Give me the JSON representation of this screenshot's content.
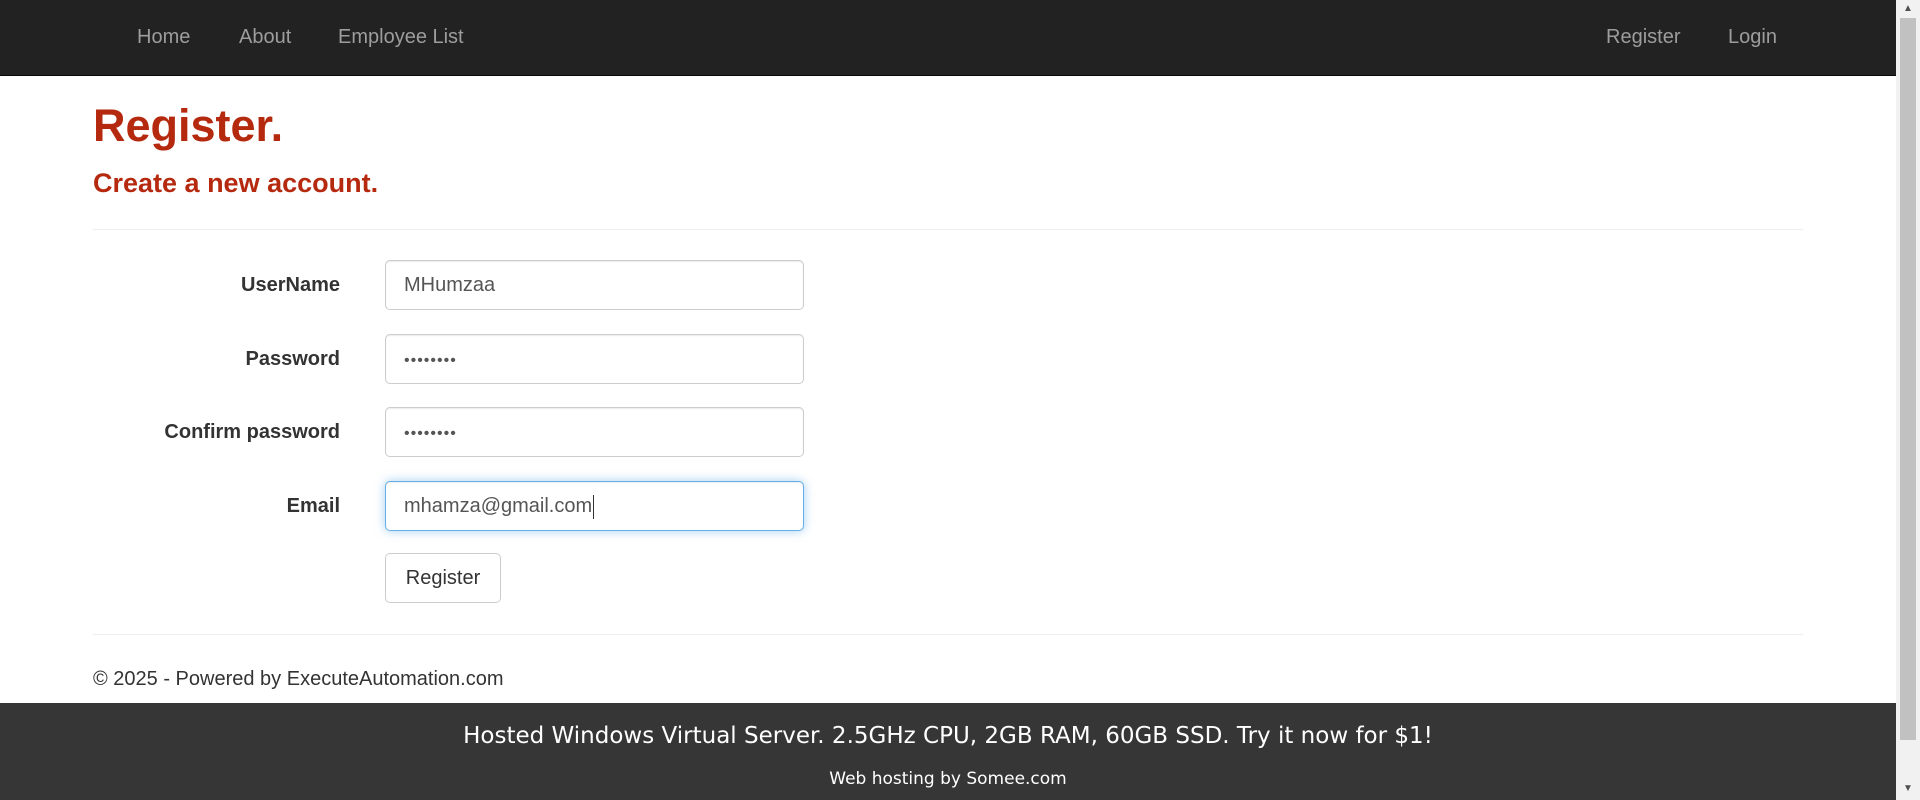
{
  "navbar": {
    "left_links": [
      "Home",
      "About",
      "Employee List"
    ],
    "right_links": [
      "Register",
      "Login"
    ]
  },
  "page": {
    "title": "Register.",
    "subtitle": "Create a new account."
  },
  "form": {
    "username_label": "UserName",
    "username_value": "MHumzaa",
    "password_label": "Password",
    "password_value": "••••••••",
    "confirm_label": "Confirm password",
    "confirm_value": "••••••••",
    "email_label": "Email",
    "email_value": "mhamza@gmail.com",
    "submit_label": "Register"
  },
  "footer": {
    "copyright": "© 2025 - Powered by ExecuteAutomation.com"
  },
  "ad": {
    "main": "Hosted Windows Virtual Server. 2.5GHz CPU, 2GB RAM, 60GB SSD. Try it now for $1!",
    "sub": "Web hosting by Somee.com"
  },
  "scrollbar": {
    "up_icon": "▲",
    "down_icon": "▼"
  }
}
